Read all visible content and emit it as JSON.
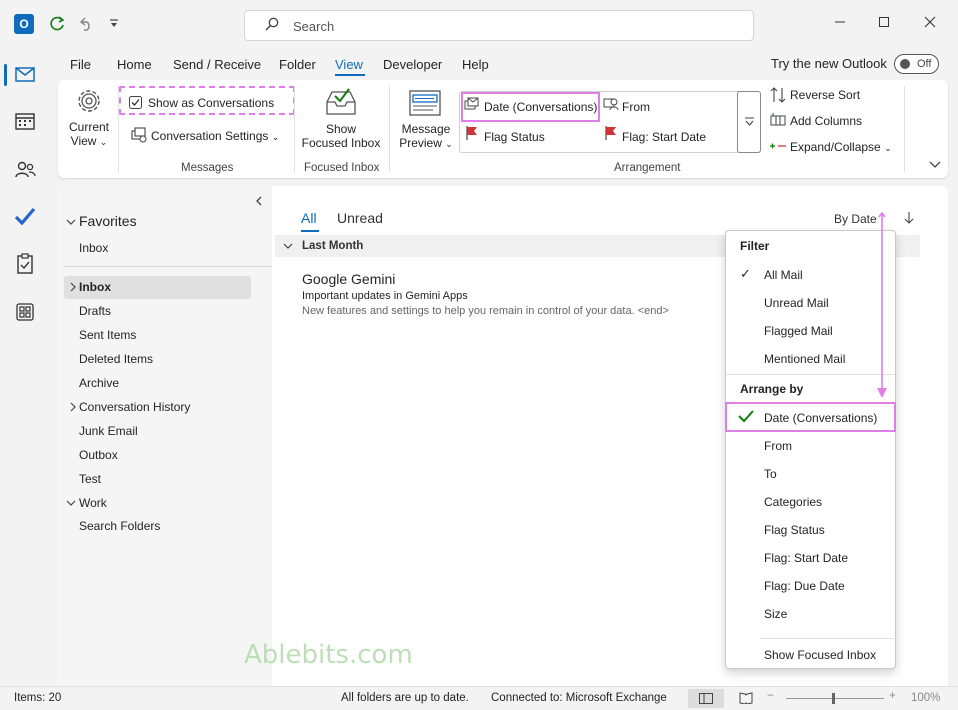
{
  "titlebar": {
    "search_placeholder": "Search"
  },
  "menu": {
    "tabs": [
      "File",
      "Home",
      "Send / Receive",
      "Folder",
      "View",
      "Developer",
      "Help"
    ],
    "active": "View",
    "try_new": "Try the new Outlook",
    "toggle_label": "Off"
  },
  "ribbon": {
    "current_view": [
      "Current",
      "View"
    ],
    "show_conversations": "Show as Conversations",
    "conversation_settings": "Conversation Settings",
    "group_messages": "Messages",
    "show_focused": [
      "Show",
      "Focused Inbox"
    ],
    "group_focused": "Focused Inbox",
    "message_preview": [
      "Message",
      "Preview"
    ],
    "arr_date": "Date (Conversations)",
    "arr_from": "From",
    "arr_flag_status": "Flag Status",
    "arr_flag_start": "Flag: Start Date",
    "group_arrangement": "Arrangement",
    "reverse_sort": "Reverse Sort",
    "add_columns": "Add Columns",
    "expand_collapse": "Expand/Collapse"
  },
  "folders": {
    "favorites": "Favorites",
    "fav_inbox": "Inbox",
    "items": [
      "Inbox",
      "Drafts",
      "Sent Items",
      "Deleted Items",
      "Archive",
      "Conversation History",
      "Junk Email",
      "Outbox",
      "Test",
      "Work",
      "Search Folders"
    ]
  },
  "list": {
    "tab_all": "All",
    "tab_unread": "Unread",
    "sort_label": "By Date",
    "group_header": "Last Month",
    "message": {
      "sender": "Google Gemini",
      "subject": "Important updates in Gemini Apps",
      "preview": "New features and settings to help you remain in control of your data. <end>"
    }
  },
  "dropdown": {
    "filter_head": "Filter",
    "filter_items": [
      "All Mail",
      "Unread Mail",
      "Flagged Mail",
      "Mentioned Mail"
    ],
    "arrange_head": "Arrange by",
    "arrange_items": [
      "Date (Conversations)",
      "From",
      "To",
      "Categories",
      "Flag Status",
      "Flag: Start Date",
      "Flag: Due Date",
      "Size"
    ],
    "show_focused": "Show Focused Inbox"
  },
  "status": {
    "items": "Items: 20",
    "sync": "All folders are up to date.",
    "connected": "Connected to: Microsoft Exchange",
    "zoom": "100%"
  },
  "watermark": "Ablebits.com",
  "colors": {
    "accent": "#0f6cbd",
    "highlight": "#e07ee8",
    "check_green": "#107c10"
  }
}
